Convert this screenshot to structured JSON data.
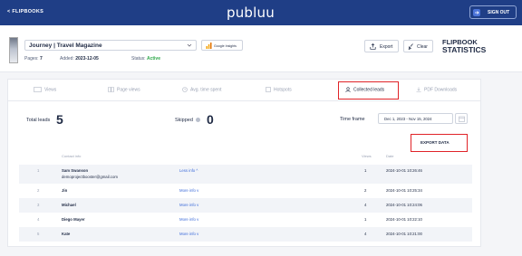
{
  "topbar": {
    "back_label": "< FLIPBOOKS",
    "logo": "publuu",
    "signout_label": "SIGN OUT"
  },
  "header": {
    "flipbook_title": "Journey | Travel Magazine",
    "google_insights_label": "Google Insights",
    "pages_label": "Pages:",
    "pages_value": "7",
    "added_label": "Added:",
    "added_value": "2023-12-05",
    "status_label": "Status:",
    "status_value": "Active",
    "export_label": "Export",
    "clear_label": "Clear",
    "stats_title_line1": "FLIPBOOK",
    "stats_title_line2": "STATISTICS"
  },
  "tabs": [
    {
      "label": "Views",
      "icon": "views-icon"
    },
    {
      "label": "Page views",
      "icon": "page-views-icon"
    },
    {
      "label": "Avg. time spent",
      "icon": "clock-icon"
    },
    {
      "label": "Hotspots",
      "icon": "hotspot-icon"
    },
    {
      "label": "Collected leads",
      "icon": "person-icon",
      "active": true
    },
    {
      "label": "PDF Downloads",
      "icon": "download-icon"
    }
  ],
  "summary": {
    "total_leads_label": "Total leads",
    "total_leads_value": "5",
    "skipped_label": "Skipped",
    "skipped_value": "0",
    "timeframe_label": "Time frame",
    "timeframe_value": "Dec 1, 2023 - Nov 15, 2024",
    "export_data_label": "EXPORT DATA"
  },
  "table": {
    "headers": {
      "contact": "Contact info",
      "views": "Views",
      "date": "Date"
    },
    "rows": [
      {
        "idx": "1",
        "name": "Sam Swanson",
        "email": "demoprojectbooster@gmail.com",
        "more": "Less info ^",
        "views": "1",
        "date": "2024-10-01 10:26:46"
      },
      {
        "idx": "2",
        "name": "Jin",
        "email": "",
        "more": "More info v",
        "views": "2",
        "date": "2024-10-01 10:25:34"
      },
      {
        "idx": "3",
        "name": "Michael",
        "email": "",
        "more": "More info v",
        "views": "4",
        "date": "2024-10-01 10:24:06"
      },
      {
        "idx": "4",
        "name": "Diego Mayer",
        "email": "",
        "more": "More info v",
        "views": "1",
        "date": "2024-10-01 10:22:10"
      },
      {
        "idx": "5",
        "name": "Kate",
        "email": "",
        "more": "More info v",
        "views": "4",
        "date": "2024-10-01 10:21:00"
      }
    ]
  },
  "colors": {
    "topbar": "#1f3e86",
    "accent": "#3b6ad9",
    "highlight": "#e02328",
    "active_status": "#2ea84a"
  }
}
